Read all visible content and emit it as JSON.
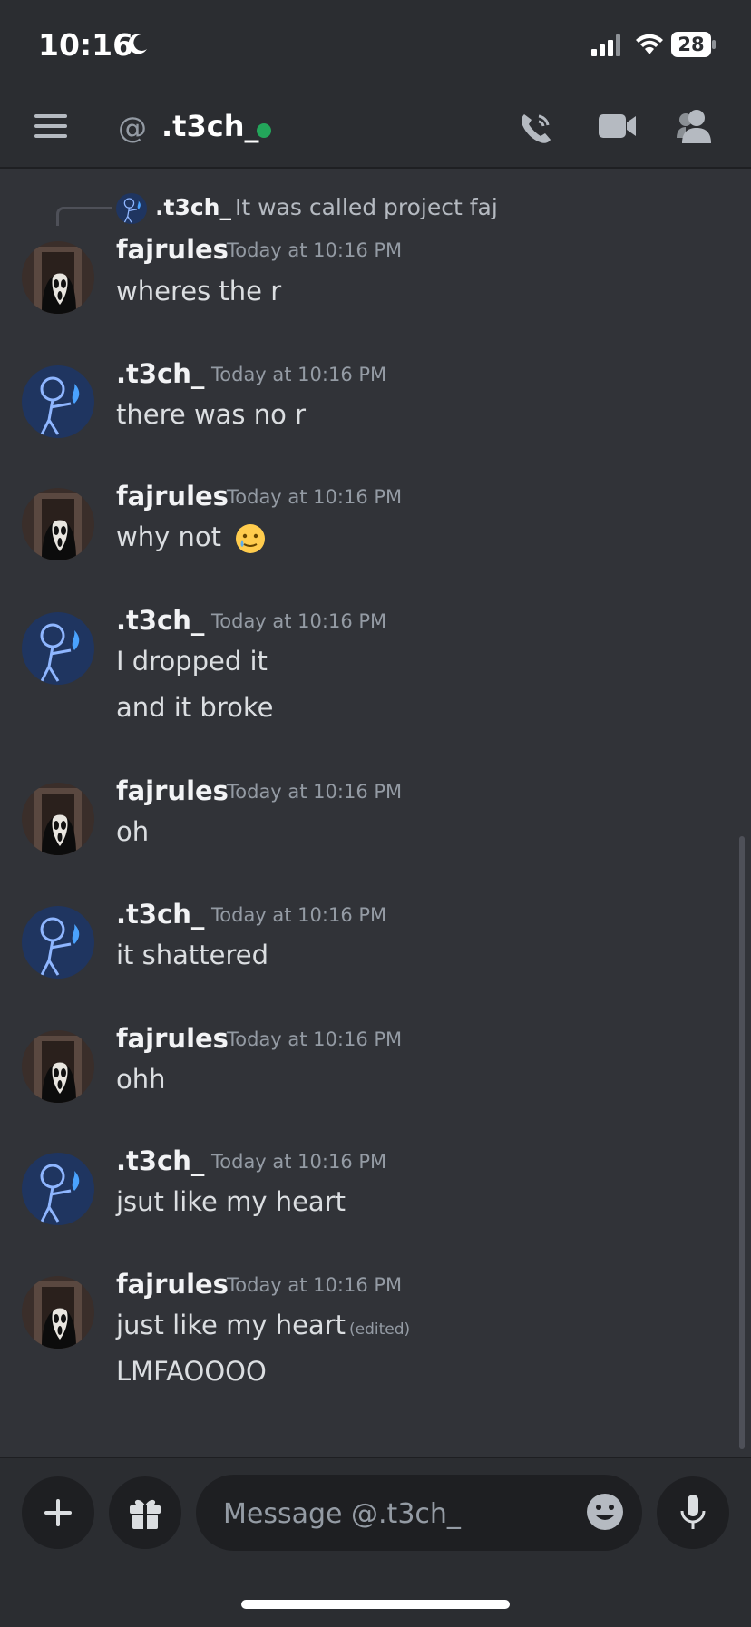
{
  "status_bar": {
    "time": "10:16",
    "battery": "28"
  },
  "header": {
    "at_symbol": "@",
    "channel_name": ".t3ch_"
  },
  "reply": {
    "author": ".t3ch_",
    "text": "It was called project faj"
  },
  "messages": [
    {
      "author": "fajrules",
      "time": "Today at 10:16 PM",
      "lines": [
        "wheres the r"
      ]
    },
    {
      "author": ".t3ch_",
      "time": "Today at 10:16 PM",
      "lines": [
        "there was no r"
      ]
    },
    {
      "author": "fajrules",
      "time": "Today at 10:16 PM",
      "lines": [
        "why not"
      ]
    },
    {
      "author": ".t3ch_",
      "time": "Today at 10:16 PM",
      "lines": [
        "I dropped it",
        "and it broke"
      ]
    },
    {
      "author": "fajrules",
      "time": "Today at 10:16 PM",
      "lines": [
        "oh"
      ]
    },
    {
      "author": ".t3ch_",
      "time": "Today at 10:16 PM",
      "lines": [
        "it shattered"
      ]
    },
    {
      "author": "fajrules",
      "time": "Today at 10:16 PM",
      "lines": [
        "ohh"
      ]
    },
    {
      "author": ".t3ch_",
      "time": "Today at 10:16 PM",
      "lines": [
        "jsut like my heart"
      ]
    },
    {
      "author": "fajrules",
      "time": "Today at 10:16 PM",
      "lines": [
        "just like my heart",
        "LMFAOOOO"
      ],
      "edited_label": "(edited)"
    }
  ],
  "composer": {
    "placeholder": "Message @.t3ch_"
  },
  "icons": {
    "moon": "moon-icon",
    "signal": "signal-icon",
    "wifi": "wifi-icon",
    "battery": "battery-icon",
    "menu": "hamburger-menu-icon",
    "at": "at-icon",
    "call": "phone-call-icon",
    "video": "video-camera-icon",
    "members": "members-icon",
    "plus": "plus-icon",
    "gift": "gift-icon",
    "emoji": "smiley-emoji-icon",
    "mic": "microphone-icon",
    "crying_face": "smiling-face-with-tear-emoji"
  },
  "colors": {
    "background": "#313338",
    "header": "#2b2d31",
    "input": "#1e1f22",
    "online": "#23a55a",
    "text": "#dbdee1",
    "muted": "#949ba4"
  }
}
